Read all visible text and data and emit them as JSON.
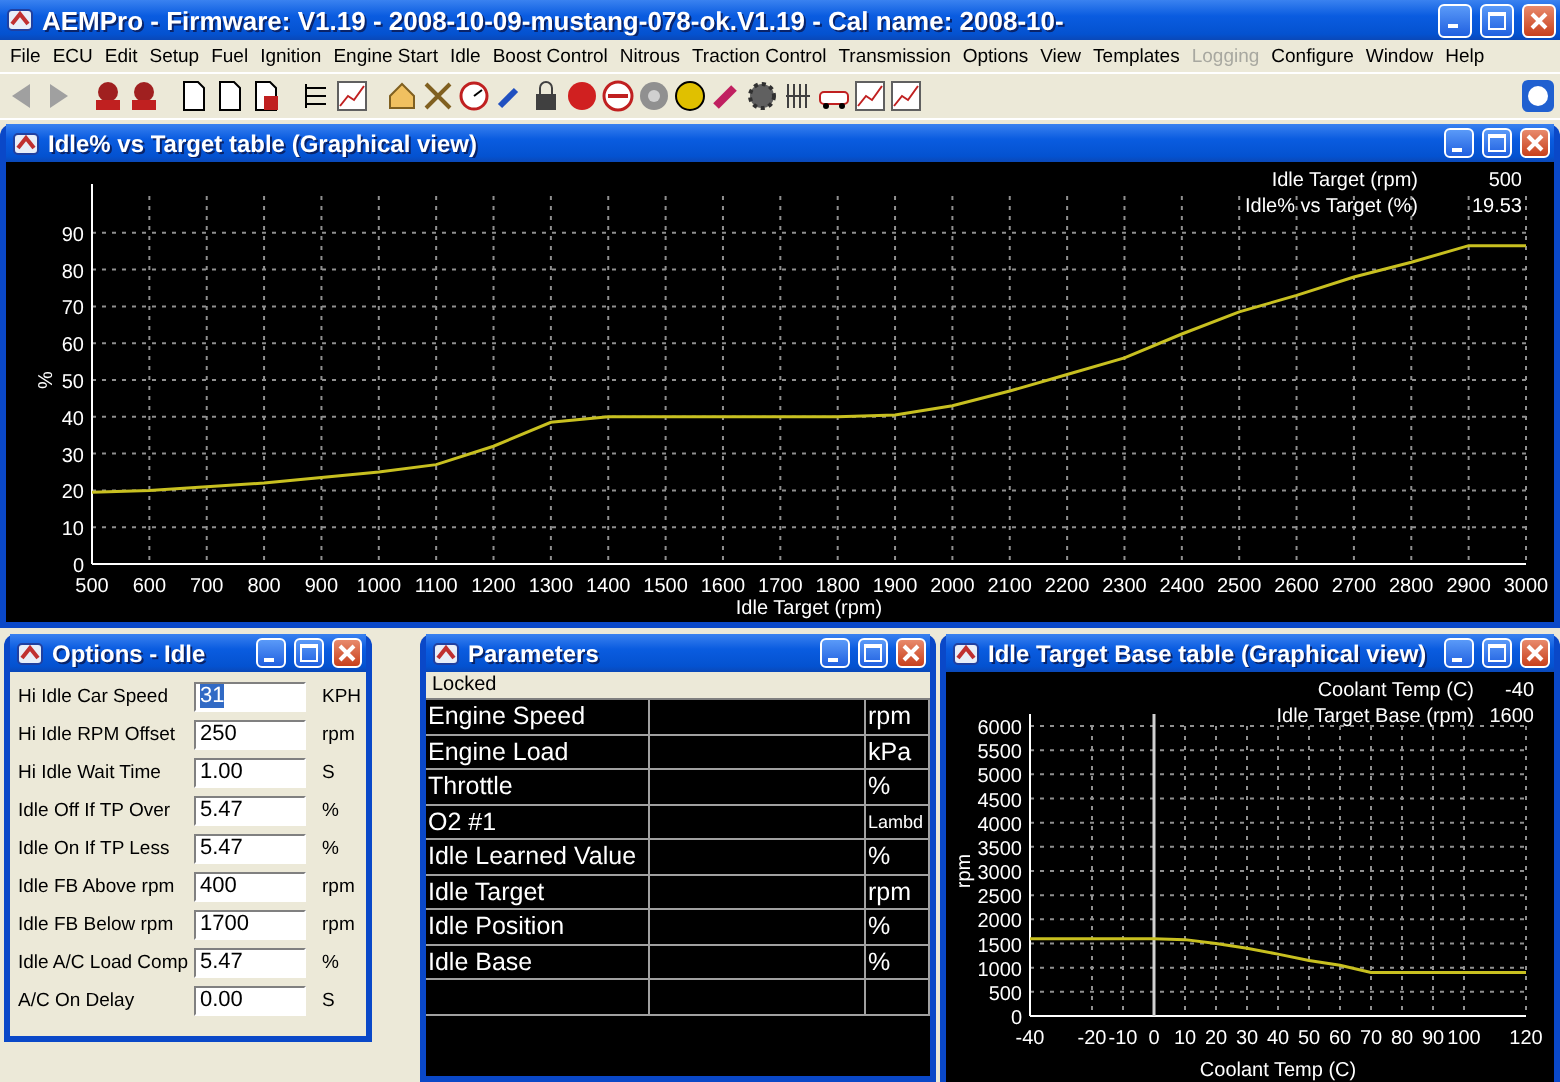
{
  "window": {
    "title": "AEMPro - Firmware: V1.19 - 2008-10-09-mustang-078-ok.V1.19 - Cal name: 2008-10-"
  },
  "menu": [
    {
      "label": "File",
      "disabled": false
    },
    {
      "label": "ECU",
      "disabled": false
    },
    {
      "label": "Edit",
      "disabled": false
    },
    {
      "label": "Setup",
      "disabled": false
    },
    {
      "label": "Fuel",
      "disabled": false
    },
    {
      "label": "Ignition",
      "disabled": false
    },
    {
      "label": "Engine Start",
      "disabled": false
    },
    {
      "label": "Idle",
      "disabled": false
    },
    {
      "label": "Boost Control",
      "disabled": false
    },
    {
      "label": "Nitrous",
      "disabled": false
    },
    {
      "label": "Traction Control",
      "disabled": false
    },
    {
      "label": "Transmission",
      "disabled": false
    },
    {
      "label": "Options",
      "disabled": false
    },
    {
      "label": "View",
      "disabled": false
    },
    {
      "label": "Templates",
      "disabled": false
    },
    {
      "label": "Logging",
      "disabled": true
    },
    {
      "label": "Configure",
      "disabled": false
    },
    {
      "label": "Window",
      "disabled": false
    },
    {
      "label": "Help",
      "disabled": false
    }
  ],
  "idle_chart_window": {
    "title": "Idle% vs Target table (Graphical view)",
    "readouts": [
      {
        "label": "Idle Target (rpm)",
        "value": "500"
      },
      {
        "label": "Idle% vs Target (%)",
        "value": "19.53"
      }
    ],
    "chart_data": {
      "type": "line",
      "xlabel": "Idle Target (rpm)",
      "ylabel": "%",
      "x": [
        500,
        600,
        700,
        800,
        900,
        1000,
        1100,
        1200,
        1300,
        1400,
        1500,
        1600,
        1700,
        1800,
        1900,
        2000,
        2100,
        2200,
        2300,
        2400,
        2500,
        2600,
        2700,
        2800,
        2900,
        3000
      ],
      "grid": true,
      "series": [
        {
          "color": "#c8c020",
          "values": [
            19.5,
            20,
            21,
            22,
            23.5,
            25,
            27,
            32,
            38.5,
            40,
            40,
            40,
            40,
            40,
            40.5,
            43,
            47,
            51.5,
            56,
            62.5,
            68.5,
            73,
            78,
            82,
            86.5,
            86.5
          ]
        }
      ],
      "xlim": [
        500,
        3000
      ],
      "ylim": [
        0,
        100
      ],
      "xticks": [
        500,
        600,
        700,
        800,
        900,
        1000,
        1100,
        1200,
        1300,
        1400,
        1500,
        1600,
        1700,
        1800,
        1900,
        2000,
        2100,
        2200,
        2300,
        2400,
        2500,
        2600,
        2700,
        2800,
        2900,
        3000
      ],
      "yticks": [
        0,
        10,
        20,
        30,
        40,
        50,
        60,
        70,
        80,
        90
      ]
    }
  },
  "options_window": {
    "title": "Options - Idle",
    "fields": [
      {
        "label": "Hi Idle Car Speed",
        "value": "31",
        "unit": "KPH",
        "highlighted": true
      },
      {
        "label": "Hi Idle RPM Offset",
        "value": "250",
        "unit": "rpm",
        "highlighted": false
      },
      {
        "label": "Hi Idle Wait Time",
        "value": "1.00",
        "unit": "S",
        "highlighted": false
      },
      {
        "label": "Idle Off If TP Over",
        "value": "5.47",
        "unit": "%",
        "highlighted": false
      },
      {
        "label": "Idle On If TP Less",
        "value": "5.47",
        "unit": "%",
        "highlighted": false
      },
      {
        "label": "Idle FB Above rpm",
        "value": "400",
        "unit": "rpm",
        "highlighted": false
      },
      {
        "label": "Idle FB Below rpm",
        "value": "1700",
        "unit": "rpm",
        "highlighted": false
      },
      {
        "label": "Idle A/C Load Comp",
        "value": "5.47",
        "unit": "%",
        "highlighted": false
      },
      {
        "label": "A/C On Delay",
        "value": "0.00",
        "unit": "S",
        "highlighted": false
      }
    ]
  },
  "parameters_window": {
    "title": "Parameters",
    "header": "Locked",
    "rows": [
      {
        "name": "Engine Speed",
        "unit": "rpm"
      },
      {
        "name": "Engine Load",
        "unit": "kPa"
      },
      {
        "name": "Throttle",
        "unit": "%"
      },
      {
        "name": "O2 #1",
        "unit": "Lambd"
      },
      {
        "name": "Idle Learned Value",
        "unit": "%"
      },
      {
        "name": "Idle Target",
        "unit": "rpm"
      },
      {
        "name": "Idle Position",
        "unit": "%"
      },
      {
        "name": "Idle Base",
        "unit": "%"
      }
    ]
  },
  "base_chart_window": {
    "title": "Idle Target Base table (Graphical view)",
    "readouts": [
      {
        "label": "Coolant Temp (C)",
        "value": "-40"
      },
      {
        "label": "Idle Target Base (rpm)",
        "value": "1600"
      }
    ],
    "chart_data": {
      "type": "line",
      "xlabel": "Coolant Temp (C)",
      "ylabel": "rpm",
      "x": [
        -40,
        -30,
        -20,
        -10,
        0,
        10,
        20,
        30,
        40,
        50,
        60,
        70,
        80,
        90,
        100,
        110,
        120
      ],
      "grid": true,
      "series": [
        {
          "color": "#c8c020",
          "values": [
            1600,
            1600,
            1600,
            1600,
            1600,
            1580,
            1500,
            1400,
            1280,
            1150,
            1050,
            900,
            900,
            900,
            900,
            900,
            900
          ]
        }
      ],
      "xlim": [
        -40,
        120
      ],
      "ylim": [
        0,
        6000
      ],
      "xticks": [
        -40,
        -20,
        -10,
        0,
        10,
        20,
        30,
        40,
        50,
        60,
        70,
        80,
        90,
        100,
        120
      ],
      "yticks": [
        0,
        500,
        1000,
        1500,
        2000,
        2500,
        3000,
        3500,
        4000,
        4500,
        5000,
        5500,
        6000
      ]
    }
  }
}
